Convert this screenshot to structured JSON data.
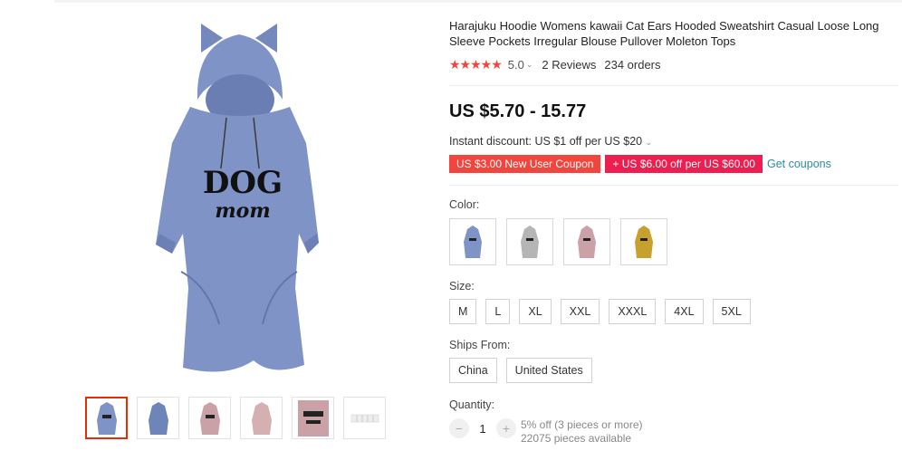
{
  "product": {
    "title": "Harajuku Hoodie Womens kawaii Cat Ears Hooded Sweatshirt Casual Loose Long Sleeve Pockets Irregular Blouse Pullover Moleton Tops",
    "rating": {
      "stars": "★★★★★",
      "score": "5.0",
      "reviews": "2 Reviews",
      "orders": "234 orders"
    },
    "price": "US $5.70 - 15.77",
    "discount": "Instant discount: US $1 off per US $20",
    "coupons": {
      "new_user": "US $3.00 New User Coupon",
      "store": "+ US $6.00 off per US $60.00",
      "get": "Get coupons"
    },
    "print": {
      "line1": "DOG",
      "line2": "mom"
    }
  },
  "options": {
    "color_label": "Color:",
    "colors": [
      "blue",
      "gray",
      "pink",
      "mustard"
    ],
    "size_label": "Size:",
    "sizes": [
      "M",
      "L",
      "XL",
      "XXL",
      "XXXL",
      "4XL",
      "5XL"
    ],
    "ships_label": "Ships From:",
    "ships": [
      "China",
      "United States"
    ]
  },
  "quantity": {
    "label": "Quantity:",
    "minus": "−",
    "value": "1",
    "plus": "+",
    "bulk": "5% off (3 pieces or more)",
    "available": "22075 pieces available"
  },
  "colors_hex": {
    "blue": "#7e93c6",
    "gray": "#b5b5b5",
    "pink": "#c9a1a6",
    "mustard": "#c8a02e",
    "accent": "#f2453d"
  }
}
